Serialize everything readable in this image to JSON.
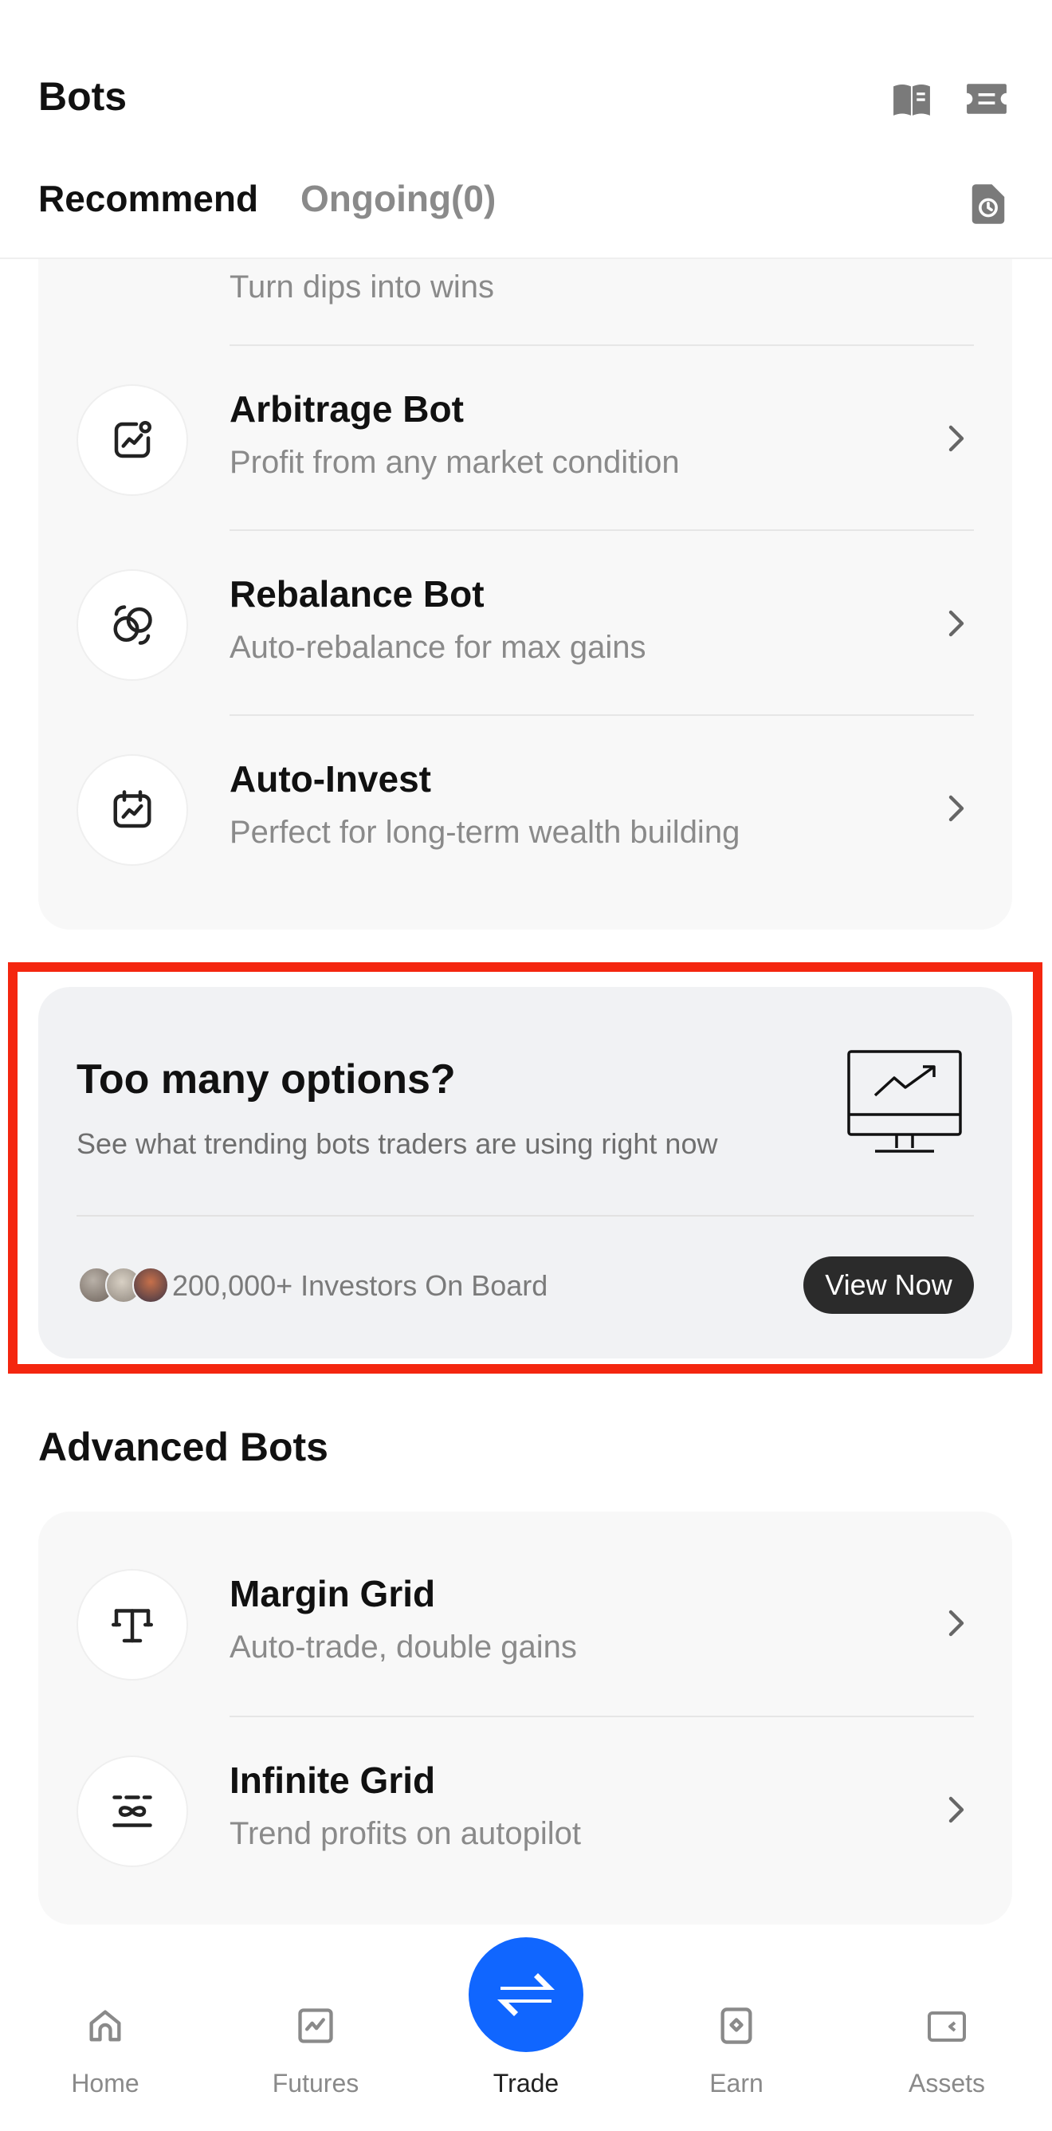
{
  "header": {
    "title": "Bots",
    "icons": [
      "book-icon",
      "ticket-icon",
      "history-icon"
    ],
    "tabs": [
      {
        "label": "Recommend",
        "active": true
      },
      {
        "label": "Ongoing(0)",
        "active": false
      }
    ]
  },
  "recommended_bots": [
    {
      "title": "",
      "subtitle": "Turn dips into wins",
      "icon": "target-icon"
    },
    {
      "title": "Arbitrage Bot",
      "subtitle": "Profit from any market condition",
      "icon": "chart-coin-icon"
    },
    {
      "title": "Rebalance Bot",
      "subtitle": "Auto-rebalance for max gains",
      "icon": "rebalance-icon"
    },
    {
      "title": "Auto-Invest",
      "subtitle": "Perfect for long-term wealth building",
      "icon": "calendar-chart-icon"
    }
  ],
  "promo": {
    "title": "Too many options?",
    "subtitle": "See what trending bots traders are using right now",
    "investors": "200,000+ Investors On Board",
    "button": "View Now",
    "icon": "monitor-chart-icon"
  },
  "advanced": {
    "section_title": "Advanced Bots",
    "items": [
      {
        "title": "Margin Grid",
        "subtitle": "Auto-trade, double gains",
        "icon": "balance-scale-icon"
      },
      {
        "title": "Infinite Grid",
        "subtitle": "Trend profits on autopilot",
        "icon": "infinity-grid-icon"
      }
    ]
  },
  "bottom_nav": {
    "items": [
      {
        "label": "Home",
        "icon": "home-icon"
      },
      {
        "label": "Futures",
        "icon": "futures-icon"
      },
      {
        "label": "Trade",
        "icon": "swap-icon",
        "active": true
      },
      {
        "label": "Earn",
        "icon": "earn-icon"
      },
      {
        "label": "Assets",
        "icon": "wallet-icon"
      }
    ]
  },
  "colors": {
    "accent": "#1066ff",
    "highlight": "#f4260f",
    "button_dark": "#2b2b2b",
    "muted_text": "#8a8a8a"
  }
}
